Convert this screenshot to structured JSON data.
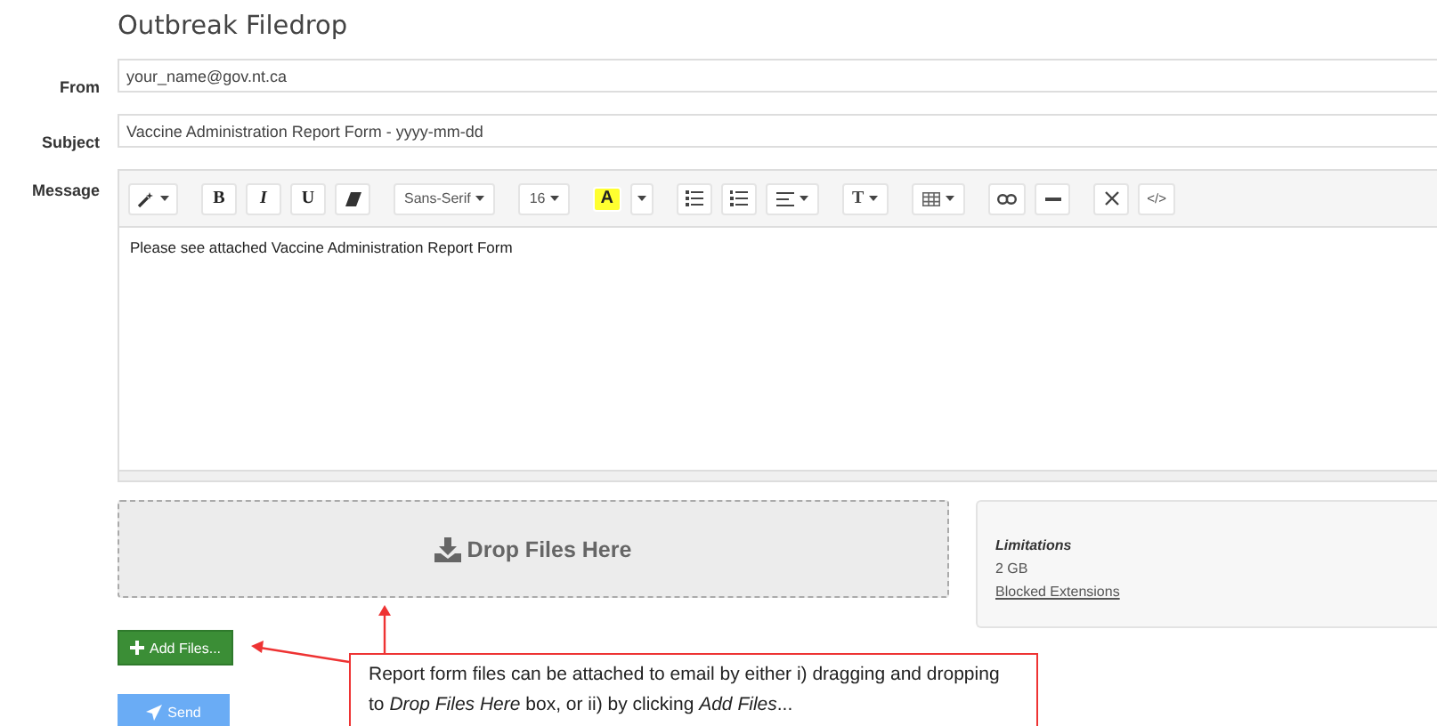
{
  "title": "Outbreak Filedrop",
  "fields": [
    {
      "label": "From",
      "value": "your_name@gov.nt.ca"
    },
    {
      "label": "Subject",
      "value": "Vaccine Administration Report Form - yyyy-mm-dd"
    }
  ],
  "message": {
    "label": "Message",
    "body": "Please see attached Vaccine Administration Report Form"
  },
  "toolbar": {
    "bold": "B",
    "italic": "I",
    "underline": "U",
    "font": "Sans-Serif",
    "size": "16",
    "highlight": "A",
    "text_style": "T",
    "code": "</>"
  },
  "dropzone": {
    "label": "Drop Files Here"
  },
  "limitations": {
    "heading": "Limitations",
    "size": "2 GB",
    "link": "Blocked Extensions"
  },
  "add_files_button": "Add Files...",
  "send_button": "Send",
  "callout": "Report form files can be attached to email by either i) dragging and dropping to *Drop Files Here* box, or ii) by clicking *Add Files*..."
}
